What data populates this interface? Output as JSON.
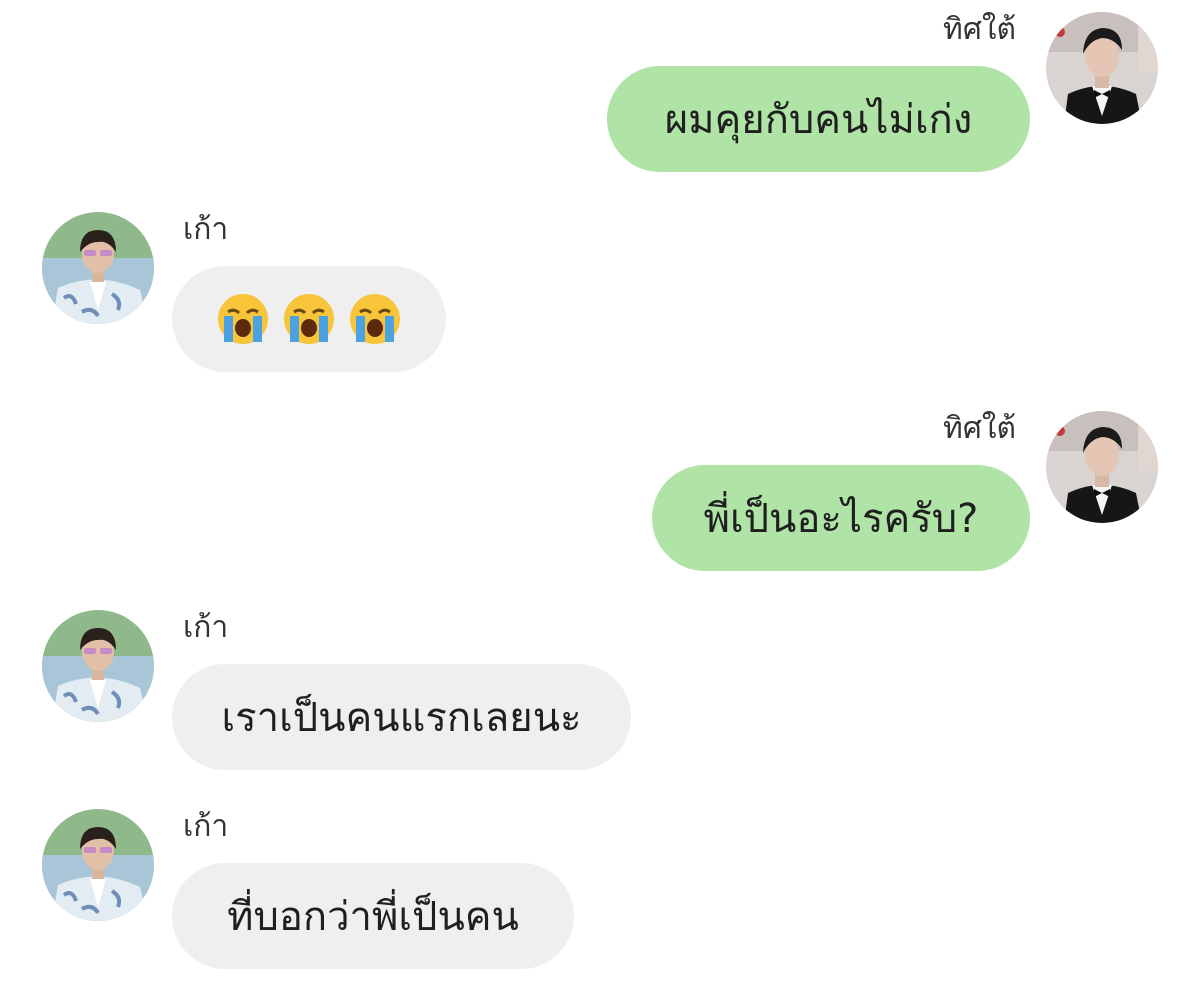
{
  "colors": {
    "mine_bubble": "#b0e3a6",
    "theirs_bubble": "#efefef",
    "text": "#1f1f1f",
    "sender_text": "#333333"
  },
  "messages": [
    {
      "side": "right",
      "sender": "ทิศใต้",
      "text": "ผมคุยกับคนไม่เก่ง",
      "avatar": "avatar-tuxedo"
    },
    {
      "side": "left",
      "sender": "เก้า",
      "emojis": [
        "loudly-crying-face",
        "loudly-crying-face",
        "loudly-crying-face"
      ],
      "avatar": "avatar-floral-shirt"
    },
    {
      "side": "right",
      "sender": "ทิศใต้",
      "text": "พี่เป็นอะไรครับ?",
      "avatar": "avatar-tuxedo"
    },
    {
      "side": "left",
      "sender": "เก้า",
      "text": "เราเป็นคนแรกเลยนะ",
      "avatar": "avatar-floral-shirt"
    },
    {
      "side": "left",
      "sender": "เก้า",
      "text": "ที่บอกว่าพี่เป็นคน",
      "avatar": "avatar-floral-shirt"
    }
  ]
}
